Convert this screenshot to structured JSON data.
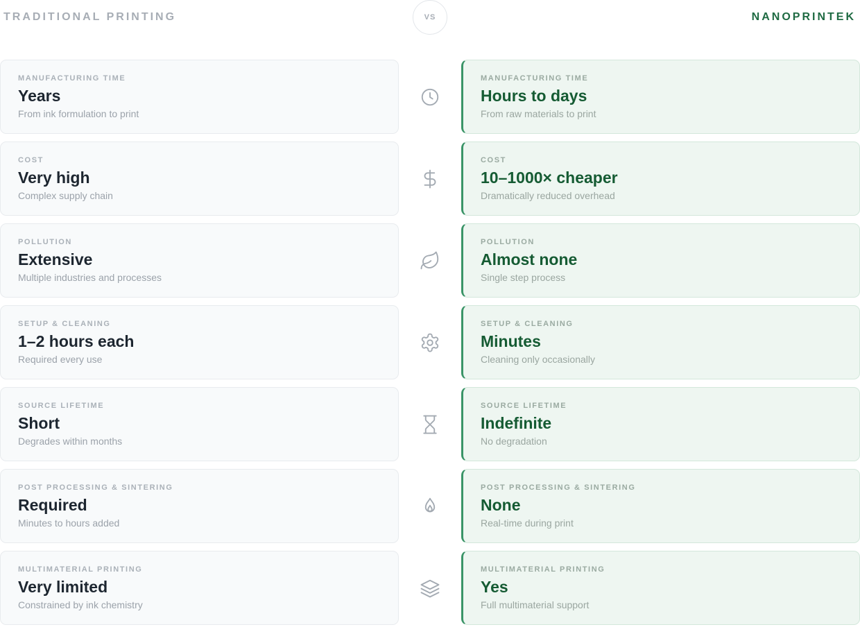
{
  "header": {
    "left_title": "TRADITIONAL PRINTING",
    "vs_label": "VS",
    "right_title": "NANOPRINTEK"
  },
  "colors": {
    "accent_green": "#1e6a42",
    "nano_border": "#3a9467",
    "muted_gray": "#a7adb5"
  },
  "rows": [
    {
      "icon": "clock-icon",
      "traditional": {
        "metric": "MANUFACTURING TIME",
        "value": "Years",
        "description": "From ink formulation to print"
      },
      "nanoprintek": {
        "metric": "MANUFACTURING TIME",
        "value": "Hours to days",
        "description": "From raw materials to print"
      }
    },
    {
      "icon": "dollar-icon",
      "traditional": {
        "metric": "COST",
        "value": "Very high",
        "description": "Complex supply chain"
      },
      "nanoprintek": {
        "metric": "COST",
        "value": "10–1000× cheaper",
        "description": "Dramatically reduced overhead"
      }
    },
    {
      "icon": "leaf-icon",
      "traditional": {
        "metric": "POLLUTION",
        "value": "Extensive",
        "description": "Multiple industries and processes"
      },
      "nanoprintek": {
        "metric": "POLLUTION",
        "value": "Almost none",
        "description": "Single step process"
      }
    },
    {
      "icon": "gear-icon",
      "traditional": {
        "metric": "SETUP & CLEANING",
        "value": "1–2 hours each",
        "description": "Required every use"
      },
      "nanoprintek": {
        "metric": "SETUP & CLEANING",
        "value": "Minutes",
        "description": "Cleaning only occasionally"
      }
    },
    {
      "icon": "hourglass-icon",
      "traditional": {
        "metric": "SOURCE LIFETIME",
        "value": "Short",
        "description": "Degrades within months"
      },
      "nanoprintek": {
        "metric": "SOURCE LIFETIME",
        "value": "Indefinite",
        "description": "No degradation"
      }
    },
    {
      "icon": "flame-icon",
      "traditional": {
        "metric": "POST PROCESSING & SINTERING",
        "value": "Required",
        "description": "Minutes to hours added"
      },
      "nanoprintek": {
        "metric": "POST PROCESSING & SINTERING",
        "value": "None",
        "description": "Real-time during print"
      }
    },
    {
      "icon": "layers-icon",
      "traditional": {
        "metric": "MULTIMATERIAL PRINTING",
        "value": "Very limited",
        "description": "Constrained by ink chemistry"
      },
      "nanoprintek": {
        "metric": "MULTIMATERIAL PRINTING",
        "value": "Yes",
        "description": "Full multimaterial support"
      }
    }
  ]
}
